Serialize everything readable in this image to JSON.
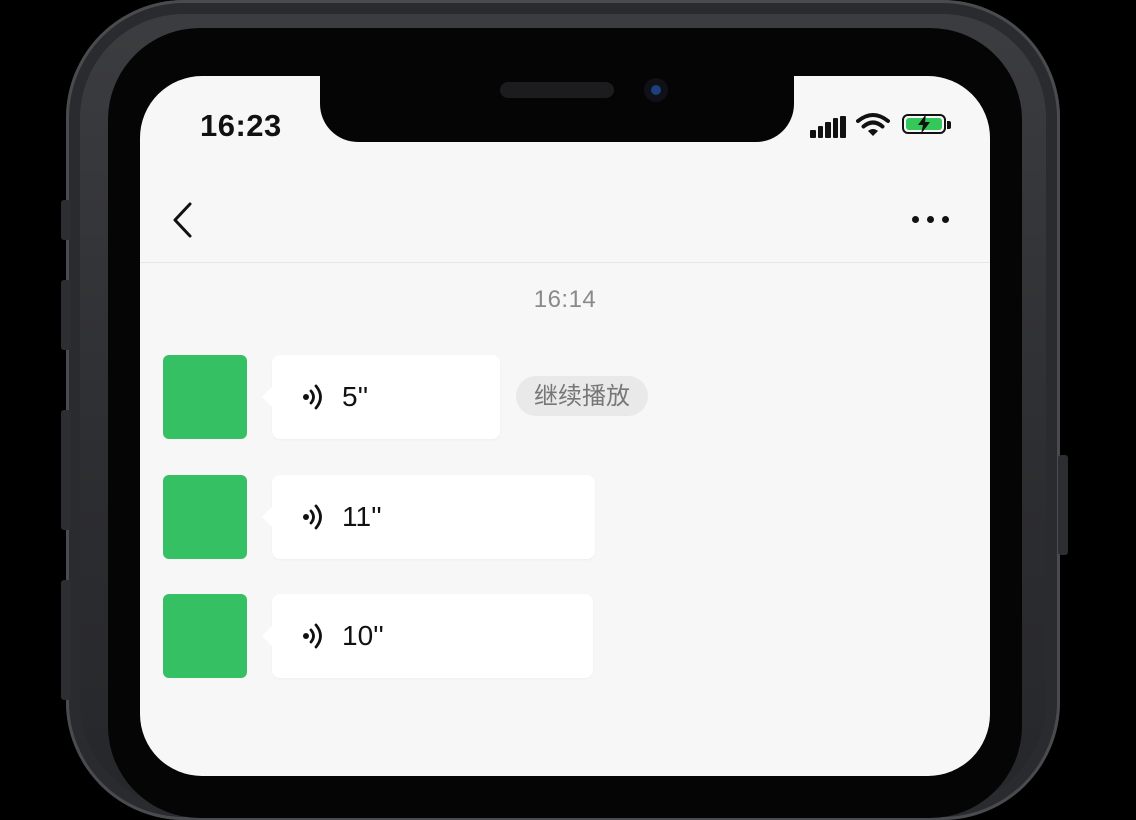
{
  "status_bar": {
    "time": "16:23"
  },
  "chat": {
    "timestamp": "16:14",
    "messages": [
      {
        "duration": "5''"
      },
      {
        "duration": "11''"
      },
      {
        "duration": "10''"
      }
    ],
    "resume_label": "继续播放"
  },
  "colors": {
    "avatar": "#36c064",
    "battery": "#34c759",
    "background": "#f7f7f7"
  },
  "icons": [
    "back-icon",
    "more-icon",
    "signal-icon",
    "wifi-icon",
    "battery-icon",
    "voice-icon"
  ]
}
